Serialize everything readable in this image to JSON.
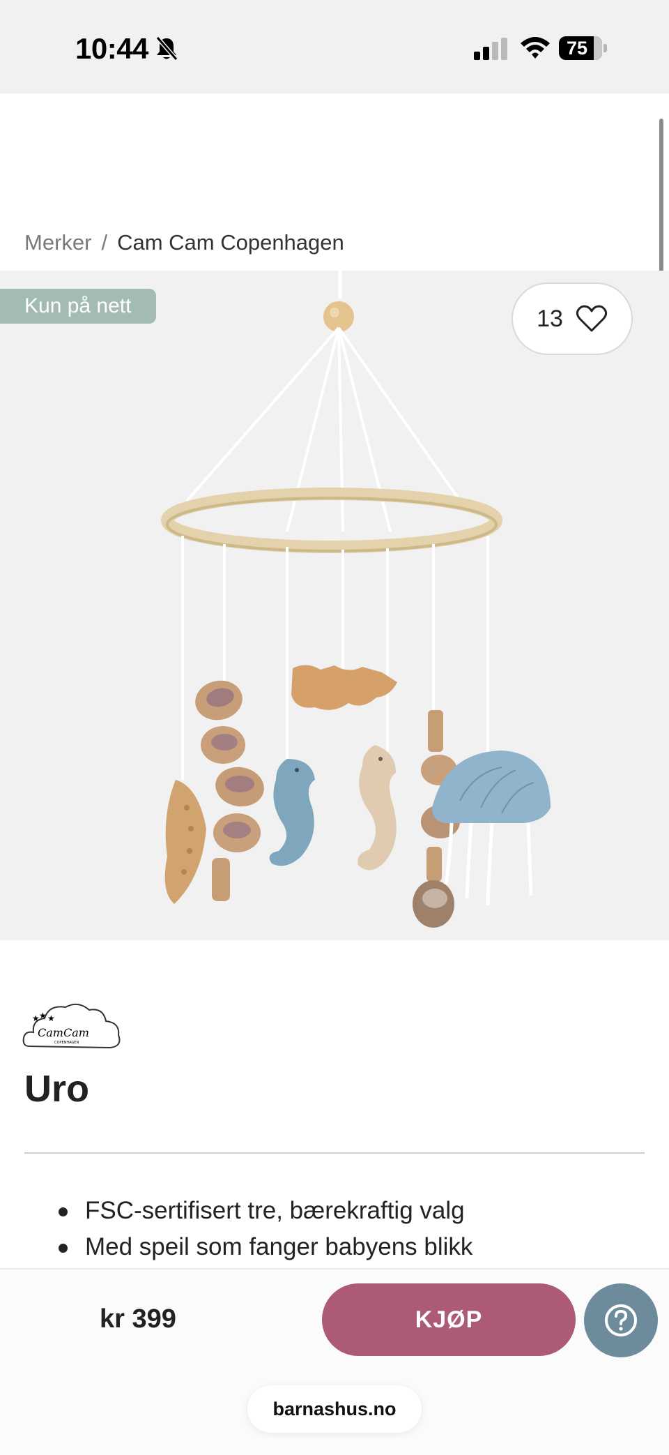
{
  "status_bar": {
    "time": "10:44",
    "battery": "75",
    "icons": [
      "bell-slash-icon",
      "cellular-signal-icon",
      "wifi-icon",
      "battery-icon"
    ]
  },
  "breadcrumb": {
    "parent": "Merker",
    "separator": "/",
    "current": "Cam Cam Copenhagen"
  },
  "product": {
    "badge": "Kun på nett",
    "favorites_count": "13",
    "brand_logo_text": "CamCam COPENHAGEN",
    "title": "Uro",
    "features": [
      "FSC-sertifisert tre, bærekraftig valg",
      "Med speil som fanger babyens blikk"
    ]
  },
  "buy_bar": {
    "price": "kr 399",
    "buy_label": "KJØP",
    "help_icon": "question-circle-icon",
    "site_url": "barnashus.no"
  },
  "colors": {
    "badge": "#a4bbb1",
    "buy_button": "#ad5a78",
    "help_button": "#6d8b9b",
    "hero_background": "#f1f1f2"
  }
}
